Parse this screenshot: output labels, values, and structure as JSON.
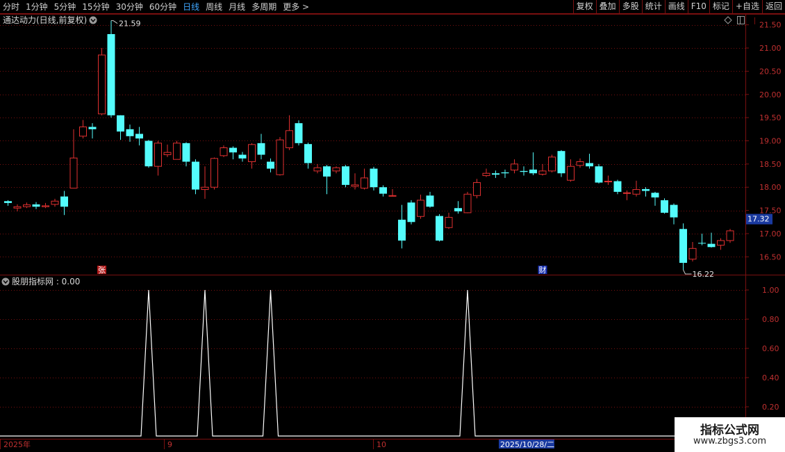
{
  "toolbar": {
    "periods": [
      "分时",
      "1分钟",
      "5分钟",
      "15分钟",
      "30分钟",
      "60分钟",
      "日线",
      "周线",
      "月线",
      "多周期",
      "更多 >"
    ],
    "active_period": "日线",
    "actions": [
      "复权",
      "叠加",
      "多股",
      "统计",
      "画线",
      "F10",
      "标记",
      "+自选",
      "返回"
    ]
  },
  "main_panel": {
    "title": "通达动力(日线,前复权)",
    "high_label": "21.59",
    "low_label": "16.22",
    "current_price_tag": "17.32",
    "y_axis_labels": [
      "21.50",
      "21.00",
      "20.50",
      "20.00",
      "19.50",
      "19.00",
      "18.50",
      "18.00",
      "17.50",
      "17.00",
      "16.50"
    ],
    "event_markers": [
      {
        "label": "张",
        "candle_index": 10,
        "color": "#b01818"
      },
      {
        "label": "财",
        "candle_index": 57,
        "color": "#1830b0"
      }
    ]
  },
  "indicator_panel": {
    "title": "股朋指标网 : 0.00",
    "y_axis_labels": [
      "1.00",
      "0.80",
      "0.60",
      "0.40",
      "0.20"
    ]
  },
  "time_axis": {
    "labels": [
      "2025年",
      "9",
      "10"
    ],
    "cursor_date": "2025/10/28/二"
  },
  "watermark": {
    "line1": "指标公式网",
    "line2": "www.zbgs3.com"
  },
  "colors": {
    "up": "#e03030",
    "down": "#54fcfc",
    "indicator": "#ffffff",
    "grid": "#7a1010",
    "cursor": "#1a3aa0"
  },
  "chart_data": {
    "type": "candlestick",
    "ohlc": [
      [
        17.7,
        17.66,
        17.6,
        17.72
      ],
      [
        17.55,
        17.58,
        17.48,
        17.63
      ],
      [
        17.58,
        17.62,
        17.55,
        17.67
      ],
      [
        17.63,
        17.58,
        17.53,
        17.68
      ],
      [
        17.58,
        17.6,
        17.55,
        17.66
      ],
      [
        17.63,
        17.7,
        17.58,
        17.75
      ],
      [
        17.8,
        17.58,
        17.4,
        17.92
      ],
      [
        17.98,
        18.63,
        17.98,
        19.25
      ],
      [
        19.1,
        19.3,
        19.05,
        19.45
      ],
      [
        19.3,
        19.25,
        19.05,
        19.38
      ],
      [
        19.58,
        20.85,
        19.55,
        21.0
      ],
      [
        21.3,
        19.55,
        19.5,
        21.59
      ],
      [
        19.55,
        19.2,
        19.02,
        19.55
      ],
      [
        19.25,
        19.1,
        18.98,
        19.35
      ],
      [
        19.15,
        19.05,
        18.9,
        19.3
      ],
      [
        19.0,
        18.45,
        18.42,
        19.02
      ],
      [
        18.45,
        18.95,
        18.25,
        19.0
      ],
      [
        18.7,
        18.75,
        18.65,
        18.92
      ],
      [
        18.6,
        18.95,
        18.6,
        19.0
      ],
      [
        18.95,
        18.55,
        18.45,
        18.97
      ],
      [
        18.55,
        17.95,
        17.85,
        18.6
      ],
      [
        17.95,
        18.0,
        17.75,
        18.45
      ],
      [
        18.0,
        18.62,
        17.95,
        18.64
      ],
      [
        18.68,
        18.85,
        18.65,
        18.9
      ],
      [
        18.85,
        18.75,
        18.6,
        18.88
      ],
      [
        18.7,
        18.62,
        18.55,
        18.76
      ],
      [
        18.55,
        18.92,
        18.4,
        18.95
      ],
      [
        18.95,
        18.7,
        18.6,
        19.15
      ],
      [
        18.55,
        18.4,
        18.32,
        18.62
      ],
      [
        18.27,
        19.02,
        18.25,
        19.08
      ],
      [
        18.85,
        19.22,
        18.8,
        19.55
      ],
      [
        19.38,
        18.95,
        18.9,
        19.44
      ],
      [
        18.93,
        18.52,
        18.4,
        18.96
      ],
      [
        18.35,
        18.42,
        18.3,
        18.5
      ],
      [
        18.45,
        18.23,
        17.85,
        18.48
      ],
      [
        18.35,
        18.42,
        18.3,
        18.45
      ],
      [
        18.45,
        18.05,
        18.0,
        18.48
      ],
      [
        18.02,
        18.05,
        17.95,
        18.3
      ],
      [
        17.98,
        18.2,
        17.95,
        18.4
      ],
      [
        18.4,
        18.0,
        17.93,
        18.44
      ],
      [
        18.0,
        17.86,
        17.8,
        18.04
      ],
      [
        17.82,
        17.82,
        17.8,
        17.96
      ],
      [
        17.3,
        16.85,
        16.68,
        17.62
      ],
      [
        17.67,
        17.25,
        17.2,
        17.72
      ],
      [
        17.37,
        17.72,
        17.32,
        17.84
      ],
      [
        17.82,
        17.58,
        17.56,
        17.9
      ],
      [
        17.38,
        16.85,
        16.83,
        17.42
      ],
      [
        17.13,
        17.35,
        17.1,
        17.45
      ],
      [
        17.55,
        17.48,
        17.43,
        17.7
      ],
      [
        17.45,
        17.85,
        17.44,
        17.9
      ],
      [
        17.82,
        18.1,
        17.76,
        18.18
      ],
      [
        18.25,
        18.3,
        18.22,
        18.4
      ],
      [
        18.3,
        18.27,
        18.2,
        18.36
      ],
      [
        18.32,
        18.3,
        18.2,
        18.38
      ],
      [
        18.37,
        18.5,
        18.3,
        18.6
      ],
      [
        18.35,
        18.33,
        18.25,
        18.45
      ],
      [
        18.38,
        18.3,
        18.26,
        18.75
      ],
      [
        18.28,
        18.35,
        18.25,
        18.5
      ],
      [
        18.35,
        18.65,
        18.32,
        18.7
      ],
      [
        18.78,
        18.3,
        18.22,
        18.8
      ],
      [
        18.15,
        18.45,
        18.12,
        18.6
      ],
      [
        18.47,
        18.55,
        18.42,
        18.62
      ],
      [
        18.52,
        18.45,
        18.4,
        18.72
      ],
      [
        18.45,
        18.1,
        18.08,
        18.5
      ],
      [
        18.12,
        18.13,
        18.05,
        18.25
      ],
      [
        18.13,
        17.9,
        17.85,
        18.16
      ],
      [
        17.88,
        17.88,
        17.72,
        17.93
      ],
      [
        17.85,
        17.95,
        17.8,
        18.14
      ],
      [
        17.96,
        17.92,
        17.8,
        18.0
      ],
      [
        17.88,
        17.78,
        17.6,
        17.9
      ],
      [
        17.72,
        17.45,
        17.43,
        17.76
      ],
      [
        17.62,
        17.35,
        17.2,
        17.65
      ],
      [
        17.1,
        16.37,
        16.22,
        17.22
      ],
      [
        16.45,
        16.68,
        16.4,
        16.82
      ],
      [
        16.8,
        16.79,
        16.75,
        17.0
      ],
      [
        16.78,
        16.71,
        16.7,
        17.02
      ],
      [
        16.75,
        16.85,
        16.65,
        16.9
      ],
      [
        16.85,
        17.06,
        16.8,
        17.1
      ]
    ],
    "indicator_values": "0 except 1.00 at candle indices 15, 21, 28 and 49",
    "indicator_spikes_at": [
      15,
      21,
      28,
      49
    ],
    "ylim_main": [
      16.13,
      21.72
    ],
    "ylim_indicator": [
      0,
      1.0
    ]
  }
}
